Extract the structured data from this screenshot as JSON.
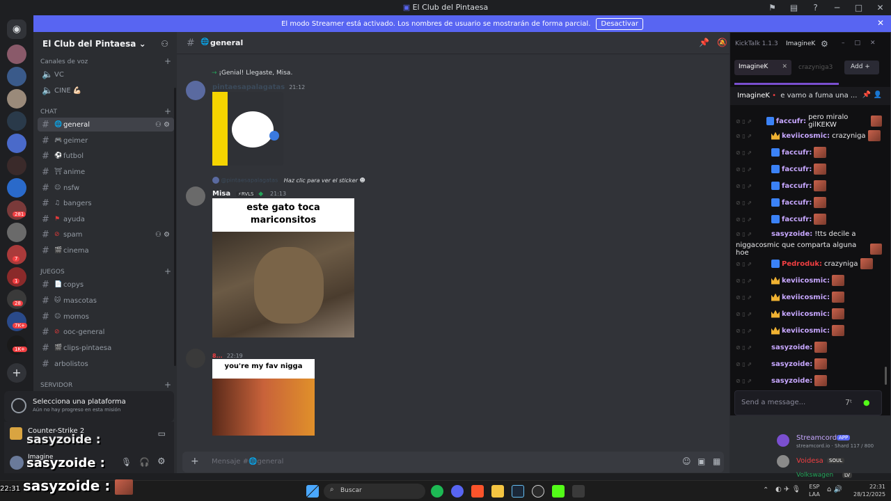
{
  "window": {
    "title": "El Club del Pintaesa"
  },
  "banner": {
    "text": "El modo Streamer está activado. Los nombres de usuario se mostrarán de forma parcial.",
    "button": "Desactivar"
  },
  "server": {
    "name": "El Club del Pintaesa"
  },
  "categories": {
    "voice": "Canales de voz",
    "chat": "CHAT",
    "juegos": "JUEGOS",
    "servidor": "SERVIDOR"
  },
  "voice_channels": [
    "VC",
    "CINE 💪🏻"
  ],
  "chat_channels": [
    "general",
    "geimer",
    "futbol",
    "anime",
    "nsfw",
    "bangers",
    "ayuda",
    "spam",
    "cinema"
  ],
  "game_channels": [
    "copys",
    "mascotas",
    "momos",
    "ooc-general",
    "clips-pintaesa",
    "arbolistos"
  ],
  "platform": {
    "title": "Selecciona una plataforma",
    "subtitle": "Aún no hay progreso en esta misión"
  },
  "activity": {
    "game": "Counter-Strike 2"
  },
  "user": {
    "name": "Imagine"
  },
  "overlay": {
    "text": "sasyzoide :"
  },
  "chat": {
    "channel": "general",
    "reply_notice": "¡Genial! Llegaste, Misa.",
    "msg1": {
      "author": "pintaesapalagatas",
      "time": "21:12"
    },
    "sticker_hint": "Haz clic para ver el sticker",
    "sticker_author": "@pintaesapalagatas",
    "msg2": {
      "author": "Misa",
      "tag": "RVLS",
      "time": "21:13",
      "image_caption": "este gato toca mariconsitos"
    },
    "msg3": {
      "author": "8...",
      "time": "22:19",
      "image_caption": "you're my fav nigga"
    },
    "composer_placeholder": "Mensaje #🌐general"
  },
  "kicktalk": {
    "title": "KickTalk 1.1.3",
    "account": "ImagineK",
    "tabs": [
      {
        "label": "ImagineK",
        "active": true
      },
      {
        "label": "crazyniga3",
        "active": false
      }
    ],
    "add_label": "Add",
    "pinned": {
      "user": "ImagineK",
      "text": "e vamo a fuma una ..."
    },
    "messages": [
      {
        "user": "faccufr:",
        "text": "pero miralo gilKEKW",
        "badge": "kick"
      },
      {
        "user": "keviicosmic:",
        "text": "crazyniga",
        "badge": "crown"
      },
      {
        "user": "faccufr:",
        "text": "",
        "badge": "kick"
      },
      {
        "user": "faccufr:",
        "text": "",
        "badge": "kick"
      },
      {
        "user": "faccufr:",
        "text": "",
        "badge": "kick"
      },
      {
        "user": "faccufr:",
        "text": "",
        "badge": "kick"
      },
      {
        "user": "faccufr:",
        "text": "",
        "badge": "kick"
      },
      {
        "user": "sasyzoide:",
        "text": "!tts decile a",
        "badge": ""
      },
      {
        "user": "",
        "text": "niggacosmic que comparta alguna hoe",
        "badge": ""
      },
      {
        "user": "Pedroduk:",
        "text": "crazyniga",
        "badge": "kick"
      },
      {
        "user": "keviicosmic:",
        "text": "",
        "badge": "crown"
      },
      {
        "user": "keviicosmic:",
        "text": "",
        "badge": "crown"
      },
      {
        "user": "keviicosmic:",
        "text": "",
        "badge": "crown"
      },
      {
        "user": "keviicosmic:",
        "text": "",
        "badge": "crown"
      },
      {
        "user": "sasyzoide:",
        "text": "",
        "badge": ""
      },
      {
        "user": "sasyzoide:",
        "text": "",
        "badge": ""
      },
      {
        "user": "sasyzoide:",
        "text": "",
        "badge": ""
      }
    ],
    "input_placeholder": "Send a message..."
  },
  "members": [
    {
      "name": "Streamcord",
      "tag": "APP",
      "sub": "streamcord.io · Shard 117 / 800"
    },
    {
      "name": "Voidesa",
      "tag": "SOUL",
      "sub": ""
    },
    {
      "name": "Volkswagen",
      "tag": "LV",
      "sub": ""
    }
  ],
  "taskbar": {
    "search": "Buscar",
    "lang": "ESP",
    "lang2": "LAA",
    "time": "22:31",
    "date": "28/12/2025"
  },
  "colors": {
    "blurple": "#5865f2",
    "sidebar": "#2b2d31",
    "chat": "#313338",
    "kick_green": "#53fc18",
    "streamer_purple": "#c7a7ff"
  }
}
